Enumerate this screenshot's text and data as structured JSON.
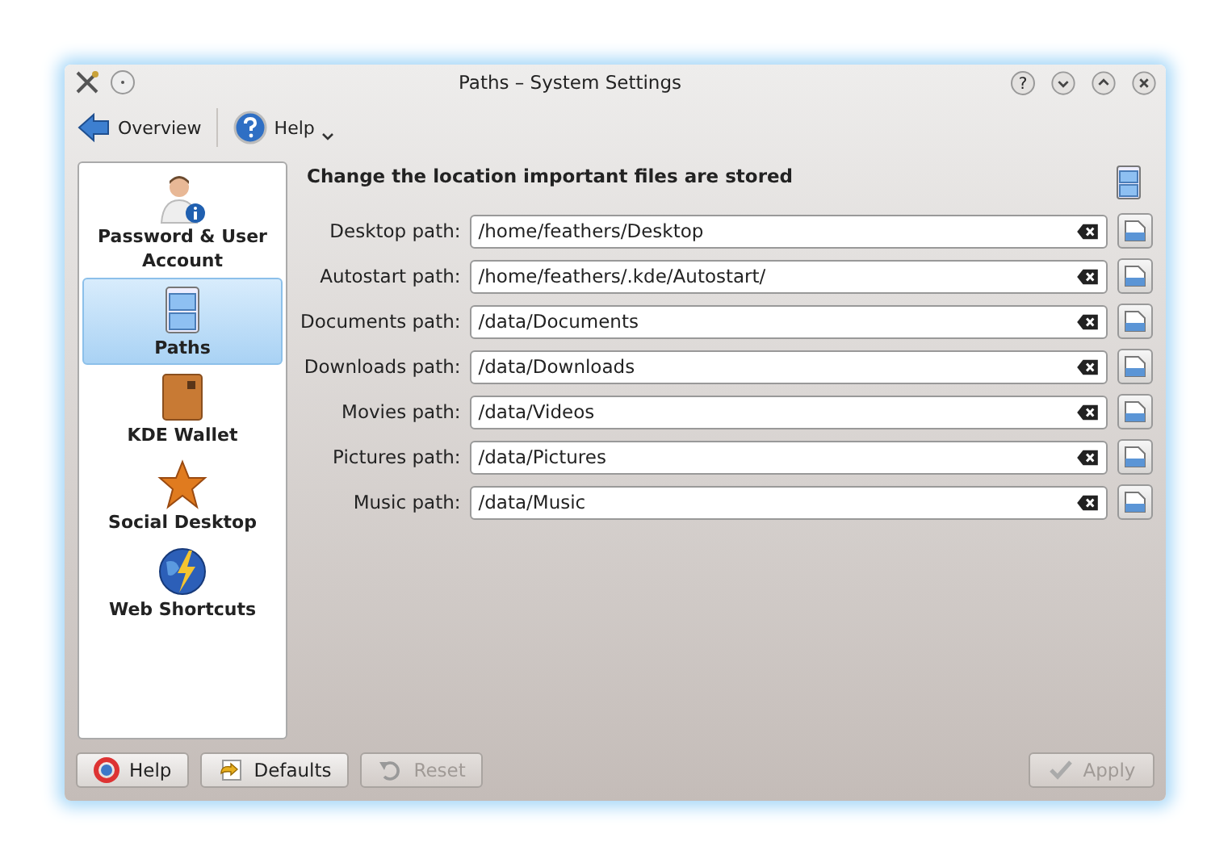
{
  "window": {
    "title": "Paths – System Settings",
    "help_glyph": "?"
  },
  "toolbar": [
    {
      "kind": "back",
      "label": "Overview"
    },
    {
      "kind": "help",
      "label": "Help"
    }
  ],
  "sidebar": {
    "items": [
      {
        "kind": "user",
        "label": "Password & User Account",
        "selected": false
      },
      {
        "kind": "cabinet",
        "label": "Paths",
        "selected": true
      },
      {
        "kind": "wallet",
        "label": "KDE Wallet",
        "selected": false
      },
      {
        "kind": "star",
        "label": "Social Desktop",
        "selected": false
      },
      {
        "kind": "globe",
        "label": "Web Shortcuts",
        "selected": false
      }
    ]
  },
  "heading": "Change the location important files are stored",
  "paths": [
    {
      "label": "Desktop path:",
      "value": "/home/feathers/Desktop"
    },
    {
      "label": "Autostart path:",
      "value": "/home/feathers/.kde/Autostart/"
    },
    {
      "label": "Documents path:",
      "value": "/data/Documents"
    },
    {
      "label": "Downloads path:",
      "value": "/data/Downloads"
    },
    {
      "label": "Movies path:",
      "value": "/data/Videos"
    },
    {
      "label": "Pictures path:",
      "value": "/data/Pictures"
    },
    {
      "label": "Music path:",
      "value": "/data/Music"
    }
  ],
  "buttons": [
    {
      "kind": "help",
      "label": "Help",
      "disabled": false
    },
    {
      "kind": "defaults",
      "label": "Defaults",
      "disabled": false
    },
    {
      "kind": "reset",
      "label": "Reset",
      "disabled": true
    },
    {
      "kind": "apply",
      "label": "Apply",
      "disabled": true
    }
  ]
}
